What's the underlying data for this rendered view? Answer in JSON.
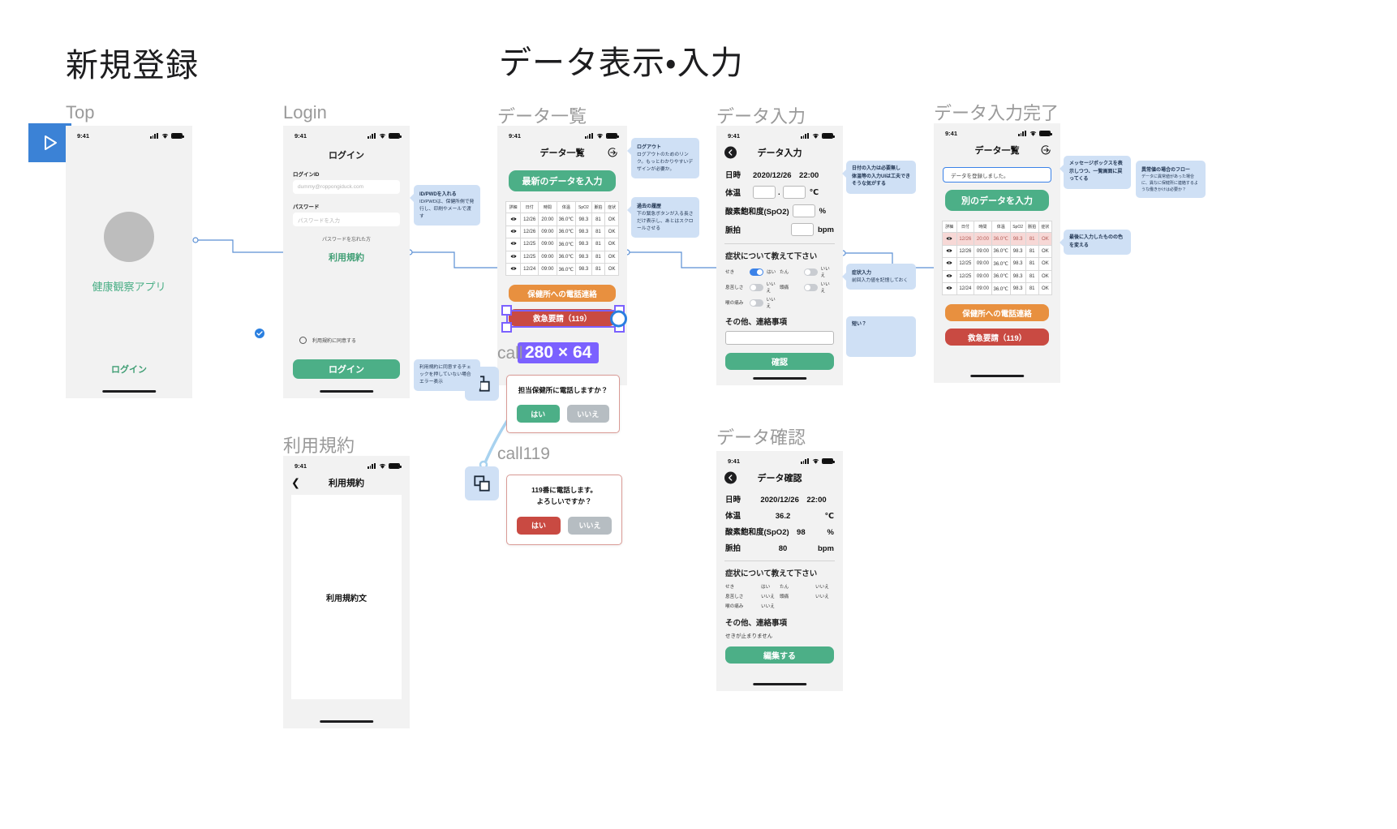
{
  "sections": {
    "signup": "新規登録",
    "data": "データ表示・入力"
  },
  "frames": {
    "top": "Top",
    "login": "Login",
    "terms": "利用規約",
    "list": "データ一覧",
    "input": "データ入力",
    "done": "データ入力完了",
    "check": "データ確認",
    "call": "call",
    "call119": "call119"
  },
  "statusbar": {
    "time": "9:41"
  },
  "top_screen": {
    "app_name": "健康観察アプリ",
    "login_link": "ログイン"
  },
  "login_screen": {
    "title": "ログイン",
    "id_label": "ログインID",
    "id_placeholder": "dummy@roppongiduck.com",
    "pw_label": "パスワード",
    "pw_placeholder": "パスワードを入力",
    "forgot": "パスワードを忘れた方",
    "terms_link": "利用規約",
    "agree_label": "利用規約に同意する",
    "login_button": "ログイン"
  },
  "terms_screen": {
    "nav_title": "利用規約",
    "body": "利用規約文"
  },
  "list_screen": {
    "nav_title": "データ一覧",
    "primary_button": "最新のデータを入力",
    "orange_button": "保健所への電話連絡",
    "red_button": "救急要請（119）",
    "table": {
      "headers": [
        "詳細",
        "日付",
        "時間",
        "体温",
        "SpO2",
        "脈拍",
        "症状"
      ],
      "rows": [
        [
          "",
          "12/26",
          "20:00",
          "36.0℃",
          "98.3",
          "81",
          "OK"
        ],
        [
          "",
          "12/26",
          "09:00",
          "36.0℃",
          "98.3",
          "81",
          "OK"
        ],
        [
          "",
          "12/25",
          "09:00",
          "36.0℃",
          "98.3",
          "81",
          "OK"
        ],
        [
          "",
          "12/25",
          "09:00",
          "36.0℃",
          "98.3",
          "81",
          "OK"
        ],
        [
          "",
          "12/24",
          "09:00",
          "36.0℃",
          "98.3",
          "81",
          "OK"
        ]
      ]
    }
  },
  "done_screen": {
    "nav_title": "データ一覧",
    "message": "データを登録しました。",
    "primary_button": "別のデータを入力",
    "orange_button": "保健所への電話連絡",
    "red_button": "救急要請（119）",
    "table": {
      "headers": [
        "詳細",
        "日付",
        "時間",
        "体温",
        "SpO2",
        "脈拍",
        "症状"
      ],
      "rows": [
        [
          "",
          "12/26",
          "20:00",
          "36.0℃",
          "98.3",
          "81",
          "OK"
        ],
        [
          "",
          "12/26",
          "09:00",
          "36.0℃",
          "98.3",
          "81",
          "OK"
        ],
        [
          "",
          "12/25",
          "09:00",
          "36.0℃",
          "98.3",
          "81",
          "OK"
        ],
        [
          "",
          "12/25",
          "09:00",
          "36.0℃",
          "98.3",
          "81",
          "OK"
        ],
        [
          "",
          "12/24",
          "09:00",
          "36.0℃",
          "98.3",
          "81",
          "OK"
        ]
      ]
    }
  },
  "input_screen": {
    "nav_title": "データ入力",
    "datetime_label": "日時",
    "datetime_value": "2020/12/26　22:00",
    "temp_label": "体温",
    "temp_unit": "℃",
    "temp_sep": ".",
    "spo2_label": "酸素飽和度(SpO2)",
    "spo2_unit": "%",
    "pulse_label": "脈拍",
    "pulse_unit": "bpm",
    "symptom_title": "症状について教えて下さい",
    "symptoms": [
      {
        "name": "せき",
        "state": "はい",
        "on": true
      },
      {
        "name": "たん",
        "state": "いいえ",
        "on": false
      },
      {
        "name": "息苦しさ",
        "state": "いいえ",
        "on": false
      },
      {
        "name": "頭痛",
        "state": "いいえ",
        "on": false
      },
      {
        "name": "喉の痛み",
        "state": "いいえ",
        "on": false
      }
    ],
    "other_title": "その他、連絡事項",
    "confirm_button": "確認"
  },
  "check_screen": {
    "nav_title": "データ確認",
    "datetime_label": "日時",
    "datetime_value": "2020/12/26　22:00",
    "temp_label": "体温",
    "temp_value": "36.2",
    "temp_unit": "℃",
    "spo2_label": "酸素飽和度(SpO2)",
    "spo2_value": "98",
    "spo2_unit": "%",
    "pulse_label": "脈拍",
    "pulse_value": "80",
    "pulse_unit": "bpm",
    "symptom_title": "症状について教えて下さい",
    "symptoms": [
      {
        "name": "せき",
        "state": "はい"
      },
      {
        "name": "たん",
        "state": "いいえ"
      },
      {
        "name": "息苦しさ",
        "state": "いいえ"
      },
      {
        "name": "頭痛",
        "state": "いいえ"
      },
      {
        "name": "喉の痛み",
        "state": "いいえ"
      }
    ],
    "other_title": "その他、連絡事項",
    "other_value": "せきが止まりません",
    "edit_button": "編集する"
  },
  "dialogs": {
    "call": {
      "label": "call",
      "text": "担当保健所に電話しますか？",
      "yes": "はい",
      "no": "いいえ"
    },
    "call119": {
      "label": "call119",
      "text_line1": "119番に電話します。",
      "text_line2": "よろしいですか？",
      "yes": "はい",
      "no": "いいえ"
    }
  },
  "notes": {
    "idpwd": {
      "title": "ID/PWDを入れる",
      "body": "ID/PWDは、保健所側で発行し、印刷やメールで渡す"
    },
    "terms_check": {
      "body": "利用規約に同意するチェックを押していない場合エラー表示"
    },
    "logout": {
      "title": "ログアウト",
      "body": "ログアウトのためのリンク。もっとわかりやすいデザインが必要か。"
    },
    "history": {
      "title": "過去の履歴",
      "body": "下の緊急ボタンが入る長さだけ表示し、あとはスクロールさせる"
    },
    "date_input": {
      "body": "日付の入力は必要無し\n体温等の入力UIは工夫できそうな気がする"
    },
    "symptom_input": {
      "title": "症状入力",
      "body": "前回入力値を記憶しておく"
    },
    "short": {
      "body": "短い？"
    },
    "messagebox": {
      "body": "メッセージボックスを表示しつつ、一覧画面に戻ってくる"
    },
    "last_input": {
      "body": "最後に入力したものの色を変える"
    },
    "abnormal": {
      "title": "異常値の場合のフロー",
      "body": "データに異常値があった場合に、異なに保健所に連絡するような働きかけは必要か？"
    }
  },
  "selection": {
    "size_badge": "280 × 64"
  },
  "colors": {
    "green": "#4caf87",
    "orange": "#e8903f",
    "red": "#c94a42",
    "note": "#cfe0f5",
    "selection": "#7b61ff",
    "accent_blue": "#3b82e8"
  }
}
